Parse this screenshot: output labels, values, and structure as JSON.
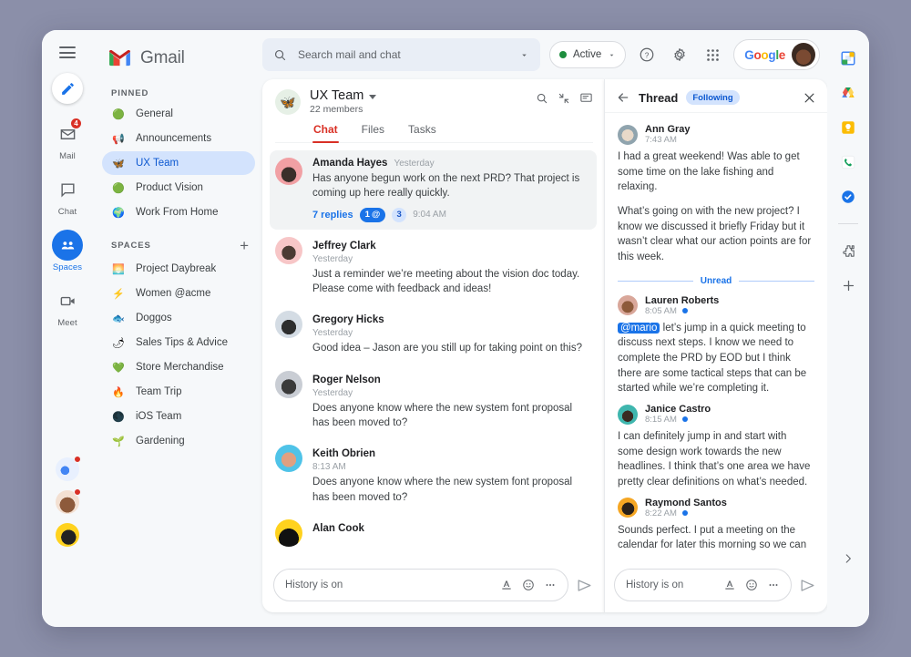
{
  "brand": {
    "name": "Gmail",
    "accent_red": "#d93025",
    "accent_blue": "#1a73e8",
    "page_bg": "#8b8fa9"
  },
  "rail": {
    "menu_icon": "hamburger-icon",
    "compose_icon": "pencil-icon",
    "items": [
      {
        "label": "Mail",
        "icon": "mail-icon",
        "badge": "4",
        "active": false
      },
      {
        "label": "Chat",
        "icon": "chat-bubble-icon",
        "badge": "",
        "active": false
      },
      {
        "label": "Spaces",
        "icon": "spaces-people-icon",
        "badge": "",
        "active": true
      },
      {
        "label": "Meet",
        "icon": "video-camera-icon",
        "badge": "",
        "active": false
      }
    ],
    "avatars": [
      {
        "name": "avatar-chat-1",
        "has_dot": true
      },
      {
        "name": "avatar-chat-2",
        "has_dot": true
      },
      {
        "name": "avatar-chat-3",
        "has_dot": false
      }
    ]
  },
  "sidebar": {
    "pinned_title": "PINNED",
    "spaces_title": "SPACES",
    "add_space_icon": "plus-icon",
    "pinned": [
      {
        "label": "General",
        "emoji": "🟢"
      },
      {
        "label": "Announcements",
        "emoji": "📢"
      },
      {
        "label": "UX Team",
        "emoji": "🦋"
      },
      {
        "label": "Product Vision",
        "emoji": "🟢"
      },
      {
        "label": "Work From Home",
        "emoji": "🌍"
      }
    ],
    "selected_item": "UX Team",
    "spaces": [
      {
        "label": "Project Daybreak",
        "emoji": "🌅"
      },
      {
        "label": "Women @acme",
        "emoji": "⚡"
      },
      {
        "label": "Doggos",
        "emoji": "🐟"
      },
      {
        "label": "Sales Tips & Advice",
        "emoji": "🌶"
      },
      {
        "label": "Store Merchandise",
        "emoji": "💚"
      },
      {
        "label": "Team Trip",
        "emoji": "🔥"
      },
      {
        "label": "iOS Team",
        "emoji": "🌑"
      },
      {
        "label": "Gardening",
        "emoji": "🌱"
      }
    ]
  },
  "topbar": {
    "search_placeholder": "Search mail and chat",
    "search_icon": "search-icon",
    "search_options_icon": "chevron-down-icon",
    "status_label": "Active",
    "status_color": "#1e8e3e",
    "help_icon": "help-circle-icon",
    "settings_icon": "gear-icon",
    "apps_icon": "apps-grid-icon",
    "google_word": "Google",
    "account_avatar": "account-avatar"
  },
  "chat": {
    "space_name": "UX Team",
    "space_emoji": "🦋",
    "members": "22 members",
    "dropdown_icon": "chevron-down-icon",
    "head_icons": [
      "search-icon",
      "collapse-arrows-icon",
      "thread-panel-icon"
    ],
    "tabs": [
      {
        "label": "Chat",
        "active": true
      },
      {
        "label": "Files",
        "active": false
      },
      {
        "label": "Tasks",
        "active": false
      }
    ],
    "messages": [
      {
        "name": "Amanda Hayes",
        "time": "Yesterday",
        "text": "Has anyone begun work on the next PRD? That project is coming up here really quickly.",
        "highlighted": true,
        "replies_label": "7 replies",
        "mention_badge": "1",
        "reply_count_badge": "3",
        "replies_time": "9:04 AM",
        "avatar_color": "#f1a0a4"
      },
      {
        "name": "Jeffrey Clark",
        "time": "Yesterday",
        "text": "Just a reminder we’re meeting about the vision doc today. Please come with feedback and ideas!",
        "highlighted": false,
        "avatar_color": "#f7c6c7"
      },
      {
        "name": "Gregory Hicks",
        "time": "Yesterday",
        "text": "Good idea – Jason are you still up for taking point on this?",
        "highlighted": false,
        "avatar_color": "#d4dce4"
      },
      {
        "name": "Roger Nelson",
        "time": "Yesterday",
        "text": "Does anyone know where the new system font proposal has been moved to?",
        "highlighted": false,
        "avatar_color": "#c9cdd4"
      },
      {
        "name": "Keith Obrien",
        "time": "8:13 AM",
        "text": "Does anyone know where the new system font proposal has been moved to?",
        "highlighted": false,
        "avatar_color": "#4fc3e8"
      },
      {
        "name": "Alan Cook",
        "time": "",
        "text": "",
        "highlighted": false,
        "avatar_color": "#ffd21e"
      }
    ],
    "composer": {
      "placeholder": "History is on",
      "format_icon": "format-text-icon",
      "emoji_icon": "emoji-smiley-icon",
      "more_icon": "more-horizontal-icon",
      "send_icon": "send-icon"
    }
  },
  "thread": {
    "back_icon": "arrow-left-icon",
    "title": "Thread",
    "following_label": "Following",
    "close_icon": "close-icon",
    "unread_separator": "Unread",
    "messages": [
      {
        "name": "Ann Gray",
        "time": "7:43 AM",
        "unread": false,
        "paragraphs": [
          "I had a great weekend! Was able to get some time on the lake fishing and relaxing.",
          "What’s going on with the new project? I know we discussed it briefly Friday but it wasn’t clear what our action points are for this week."
        ],
        "avatar_color": "#cfd8dc"
      },
      {
        "name": "Lauren Roberts",
        "time": "8:05 AM",
        "unread": true,
        "mention": "@mario",
        "paragraphs": [
          " let’s jump in a quick meeting to discuss next steps. I know we need to complete the PRD by EOD but I think there are some tactical steps that can be started while we’re completing it."
        ],
        "avatar_color": "#b98d7a"
      },
      {
        "name": "Janice Castro",
        "time": "8:15 AM",
        "unread": true,
        "paragraphs": [
          "I can definitely jump in and start with some design work towards the new headlines. I think that’s one area we have pretty clear definitions on what’s needed."
        ],
        "avatar_color": "#3fb6ae"
      },
      {
        "name": "Raymond Santos",
        "time": "8:22 AM",
        "unread": true,
        "paragraphs": [
          "Sounds perfect. I put a meeting on the calendar for later this morning so we can"
        ],
        "avatar_color": "#f5a623"
      }
    ],
    "composer": {
      "placeholder": "History is on",
      "format_icon": "format-text-icon",
      "emoji_icon": "emoji-smiley-icon",
      "more_icon": "more-horizontal-icon",
      "send_icon": "send-icon"
    }
  },
  "app_rail": {
    "icons": [
      {
        "name": "google-calendar-icon",
        "glyph": "🗓"
      },
      {
        "name": "google-drive-icon",
        "glyph": "△"
      },
      {
        "name": "google-keep-icon",
        "glyph": "💡"
      },
      {
        "name": "google-voice-icon",
        "glyph": "📞"
      },
      {
        "name": "google-tasks-icon",
        "glyph": "✔"
      }
    ],
    "addon_icon": "puzzle-piece-icon",
    "add_icon": "plus-icon",
    "expand_icon": "chevron-right-icon"
  }
}
